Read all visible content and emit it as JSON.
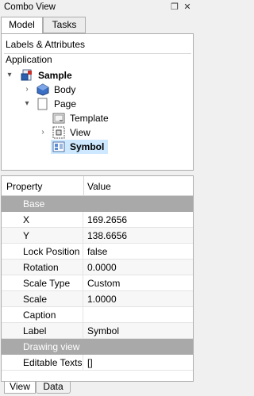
{
  "window": {
    "title": "Combo View"
  },
  "top_tabs": [
    {
      "label": "Model"
    },
    {
      "label": "Tasks"
    }
  ],
  "tree": {
    "header": "Labels & Attributes",
    "app_label": "Application",
    "items": [
      {
        "label": "Sample",
        "icon": "document-icon"
      },
      {
        "label": "Body",
        "icon": "body-icon"
      },
      {
        "label": "Page",
        "icon": "page-icon"
      },
      {
        "label": "Template",
        "icon": "template-icon"
      },
      {
        "label": "View",
        "icon": "view-icon"
      },
      {
        "label": "Symbol",
        "icon": "symbol-icon"
      }
    ]
  },
  "properties": {
    "headers": {
      "name": "Property",
      "value": "Value"
    },
    "groups": [
      {
        "label": "Base"
      },
      {
        "label": "Drawing view"
      }
    ],
    "rows": [
      {
        "name": "X",
        "value": "169.2656"
      },
      {
        "name": "Y",
        "value": "138.6656"
      },
      {
        "name": "Lock Position",
        "value": "false"
      },
      {
        "name": "Rotation",
        "value": "0.0000"
      },
      {
        "name": "Scale Type",
        "value": "Custom"
      },
      {
        "name": "Scale",
        "value": "1.0000"
      },
      {
        "name": "Caption",
        "value": ""
      },
      {
        "name": "Label",
        "value": "Symbol"
      },
      {
        "name": "Editable Texts",
        "value": "[]"
      }
    ]
  },
  "bottom_tabs": [
    {
      "label": "View"
    },
    {
      "label": "Data"
    }
  ]
}
